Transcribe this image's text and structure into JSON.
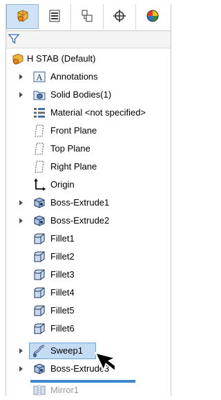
{
  "tabs": [
    {
      "icon": "part-feature-manager-icon"
    },
    {
      "icon": "property-manager-icon"
    },
    {
      "icon": "configuration-manager-icon"
    },
    {
      "icon": "dimxpert-manager-icon"
    },
    {
      "icon": "display-manager-icon"
    }
  ],
  "filter": {
    "icon": "filter-icon"
  },
  "tree": {
    "root": "H STAB  (Default)",
    "items": [
      {
        "label": "Annotations"
      },
      {
        "label": "Solid Bodies(1)"
      },
      {
        "label": "Material <not specified>"
      },
      {
        "label": "Front Plane"
      },
      {
        "label": "Top Plane"
      },
      {
        "label": "Right Plane"
      },
      {
        "label": "Origin"
      },
      {
        "label": "Boss-Extrude1"
      },
      {
        "label": "Boss-Extrude2"
      },
      {
        "label": "Fillet1"
      },
      {
        "label": "Fillet2"
      },
      {
        "label": "Fillet3"
      },
      {
        "label": "Fillet4"
      },
      {
        "label": "Fillet5"
      },
      {
        "label": "Fillet6"
      },
      {
        "label": "Sweep1"
      },
      {
        "label": "Boss-Extrude3"
      },
      {
        "label": "Mirror1"
      }
    ]
  },
  "colors": {
    "selection": "#c4dcf3",
    "accent": "#3d87cf",
    "part_icon": "#e8a317"
  }
}
